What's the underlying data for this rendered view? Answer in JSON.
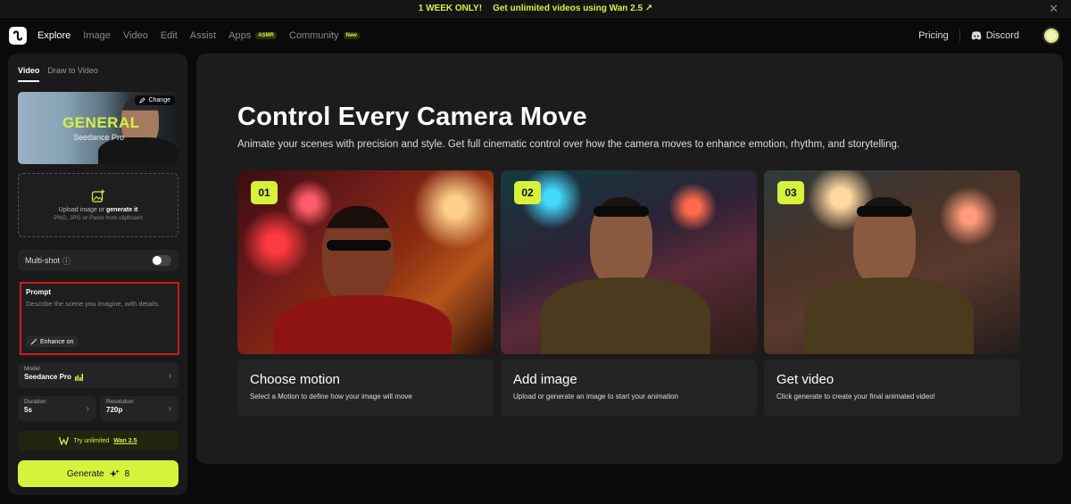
{
  "banner": {
    "tag": "1 WEEK ONLY!",
    "cta": "Get unlimited videos using Wan 2.5",
    "arrow": "↗",
    "close": "✕"
  },
  "nav": {
    "links": [
      "Explore",
      "Image",
      "Video",
      "Edit",
      "Assist",
      "Apps",
      "Community"
    ],
    "apps_tag": "ASMR",
    "community_tag": "New",
    "pricing": "Pricing",
    "discord": "Discord"
  },
  "sidebar": {
    "tabs": [
      "Video",
      "Draw to Video"
    ],
    "model_card": {
      "title": "GENERAL",
      "subtitle": "Seedance Pro",
      "change": "Change"
    },
    "upload": {
      "line1_pre": "Upload image or ",
      "line1_link": "generate it",
      "line2": "PNG, JPG or Paste from clipboard"
    },
    "multishot": {
      "label": "Multi-shot",
      "info_icon": "ⓘ"
    },
    "prompt": {
      "label": "Prompt",
      "placeholder": "Describe the scene you imagine, with details.",
      "enhance": "Enhance on"
    },
    "model": {
      "label": "Model",
      "value": "Seedance Pro"
    },
    "duration": {
      "label": "Duration",
      "value": "5s"
    },
    "resolution": {
      "label": "Resolution",
      "value": "720p"
    },
    "try": {
      "pre": "Try unlimited",
      "link": "Wan 2.5"
    },
    "generate": {
      "label": "Generate",
      "cost": "8"
    }
  },
  "main": {
    "title": "Control Every Camera Move",
    "subtitle": "Animate your scenes with precision and style. Get full cinematic control over how the camera moves to enhance emotion, rhythm, and storytelling.",
    "steps": [
      {
        "num": "01",
        "title": "Choose motion",
        "desc": "Select a Motion to define how your image will move"
      },
      {
        "num": "02",
        "title": "Add image",
        "desc": "Upload or generate an image to start your animation"
      },
      {
        "num": "03",
        "title": "Get video",
        "desc": "Click generate to create your final animated video!"
      }
    ]
  },
  "colors": {
    "accent": "#d6f23a",
    "highlight_border": "#d4191b"
  }
}
